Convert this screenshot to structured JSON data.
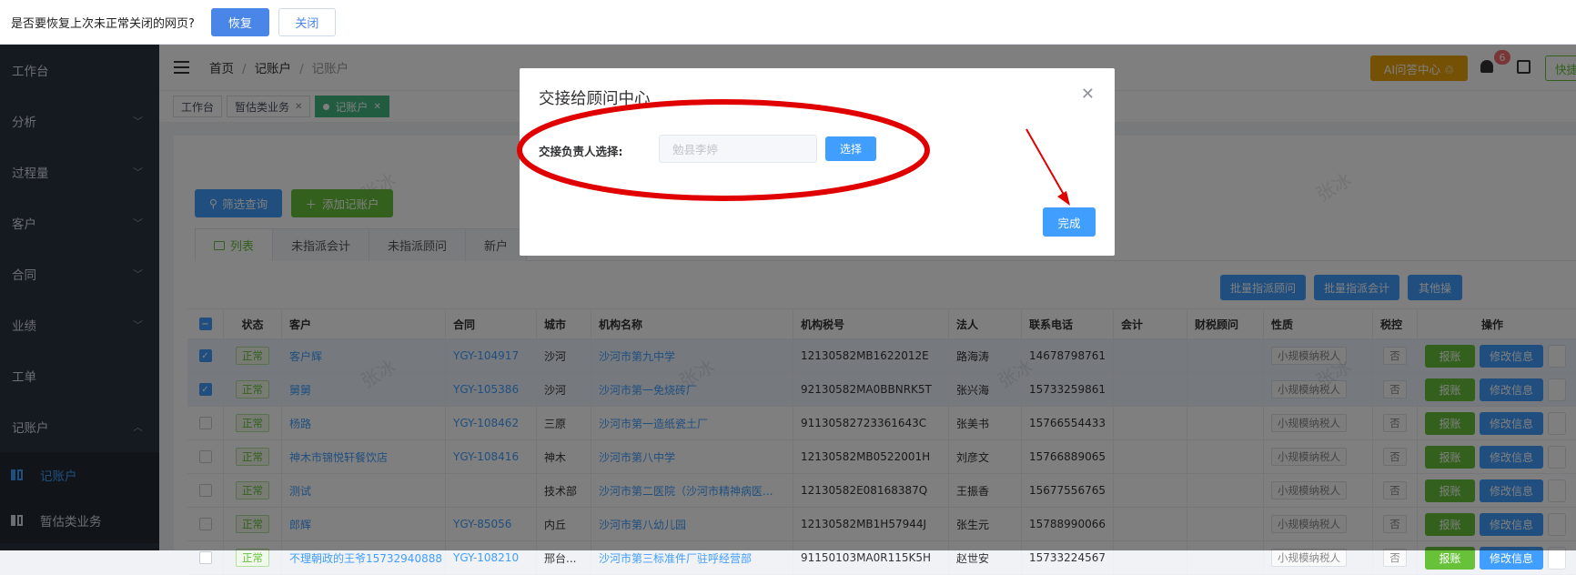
{
  "restore_bar": {
    "message": "是否要恢复上次未正常关闭的网页?",
    "restore_label": "恢复",
    "close_label": "关闭"
  },
  "sidebar": {
    "items": [
      {
        "label": "工作台",
        "expandable": false
      },
      {
        "label": "分析",
        "expandable": true
      },
      {
        "label": "过程量",
        "expandable": true
      },
      {
        "label": "客户",
        "expandable": true
      },
      {
        "label": "合同",
        "expandable": true
      },
      {
        "label": "业绩",
        "expandable": true
      },
      {
        "label": "工单",
        "expandable": false
      },
      {
        "label": "记账户",
        "expandable": true,
        "expanded": true
      }
    ],
    "sub_items": [
      {
        "label": "记账户",
        "active": true
      },
      {
        "label": "暂估类业务",
        "active": false
      }
    ]
  },
  "header": {
    "breadcrumb": [
      "首页",
      "记账户",
      "记账户"
    ],
    "ai_label": "AI问答中心 ♲",
    "notification_count": "6",
    "quick_label": "快捷"
  },
  "tags": [
    {
      "label": "工作台",
      "active": false,
      "closable": false
    },
    {
      "label": "暂估类业务",
      "active": false,
      "closable": true
    },
    {
      "label": "记账户",
      "active": true,
      "closable": true
    }
  ],
  "toolbar": {
    "filter_label": "筛选查询",
    "add_label": "添加记账户"
  },
  "tabs": [
    "列表",
    "未指派会计",
    "未指派顾问",
    "新户"
  ],
  "bulk_actions": [
    "批量指派顾问",
    "批量指派会计",
    "其他操"
  ],
  "table": {
    "headers": [
      "状态",
      "客户",
      "合同",
      "城市",
      "机构名称",
      "机构税号",
      "法人",
      "联系电话",
      "会计",
      "财税顾问",
      "性质",
      "税控",
      "操作"
    ],
    "rows": [
      {
        "checked": true,
        "status": "正常",
        "customer": "客户辉",
        "contract": "YGY-104917",
        "city": "沙河",
        "org": "沙河市第九中学",
        "tax_id": "12130582MB1622012E",
        "legal": "路海涛",
        "phone": "14678798761",
        "nature": "小规模纳税人",
        "taxctl": "否"
      },
      {
        "checked": true,
        "status": "正常",
        "customer": "舅舅",
        "contract": "YGY-105386",
        "city": "沙河",
        "org": "沙河市第一免烧砖厂",
        "tax_id": "92130582MA0BBNRK5T",
        "legal": "张兴海",
        "phone": "15733259861",
        "nature": "小规模纳税人",
        "taxctl": "否"
      },
      {
        "checked": false,
        "status": "正常",
        "customer": "杨路",
        "contract": "YGY-108462",
        "city": "三原",
        "org": "沙河市第一造纸瓷土厂",
        "tax_id": "91130582723361643C",
        "legal": "张美书",
        "phone": "15766554433",
        "nature": "小规模纳税人",
        "taxctl": "否"
      },
      {
        "checked": false,
        "status": "正常",
        "customer": "神木市锦悦轩餐饮店",
        "contract": "YGY-108416",
        "city": "神木",
        "org": "沙河市第八中学",
        "tax_id": "12130582MB0522001H",
        "legal": "刘彦文",
        "phone": "15766889065",
        "nature": "小规模纳税人",
        "taxctl": "否"
      },
      {
        "checked": false,
        "status": "正常",
        "customer": "测试",
        "contract": "",
        "city": "技术部",
        "org": "沙河市第二医院（沙河市精神病医...",
        "tax_id": "12130582E08168387Q",
        "legal": "王振香",
        "phone": "15677556765",
        "nature": "小规模纳税人",
        "taxctl": "否"
      },
      {
        "checked": false,
        "status": "正常",
        "customer": "郎辉",
        "contract": "YGY-85056",
        "city": "内丘",
        "org": "沙河市第八幼儿园",
        "tax_id": "12130582MB1H57944J",
        "legal": "张生元",
        "phone": "15788990066",
        "nature": "小规模纳税人",
        "taxctl": "否"
      },
      {
        "checked": false,
        "status": "正常",
        "customer": "不理朝政的王爷15732940888",
        "contract": "YGY-108210",
        "city": "邢台...",
        "org": "沙河市第三标准件厂驻呼经营部",
        "tax_id": "91150103MA0R115K5H",
        "legal": "赵世安",
        "phone": "15733224567",
        "nature": "小规模纳税人",
        "taxctl": "否"
      }
    ],
    "row_actions": {
      "report": "报账",
      "edit": "修改信息"
    }
  },
  "watermark": "张冰",
  "dialog": {
    "title": "交接给顾问中心",
    "field_label": "交接负责人选择:",
    "field_value": "勉县李婷",
    "choose_label": "选择",
    "done_label": "完成"
  },
  "colors": {
    "primary": "#409eff",
    "success": "#67c23a",
    "sidebar": "#2b3441",
    "annotation": "#e00000",
    "ai_button": "#e8a30b"
  }
}
